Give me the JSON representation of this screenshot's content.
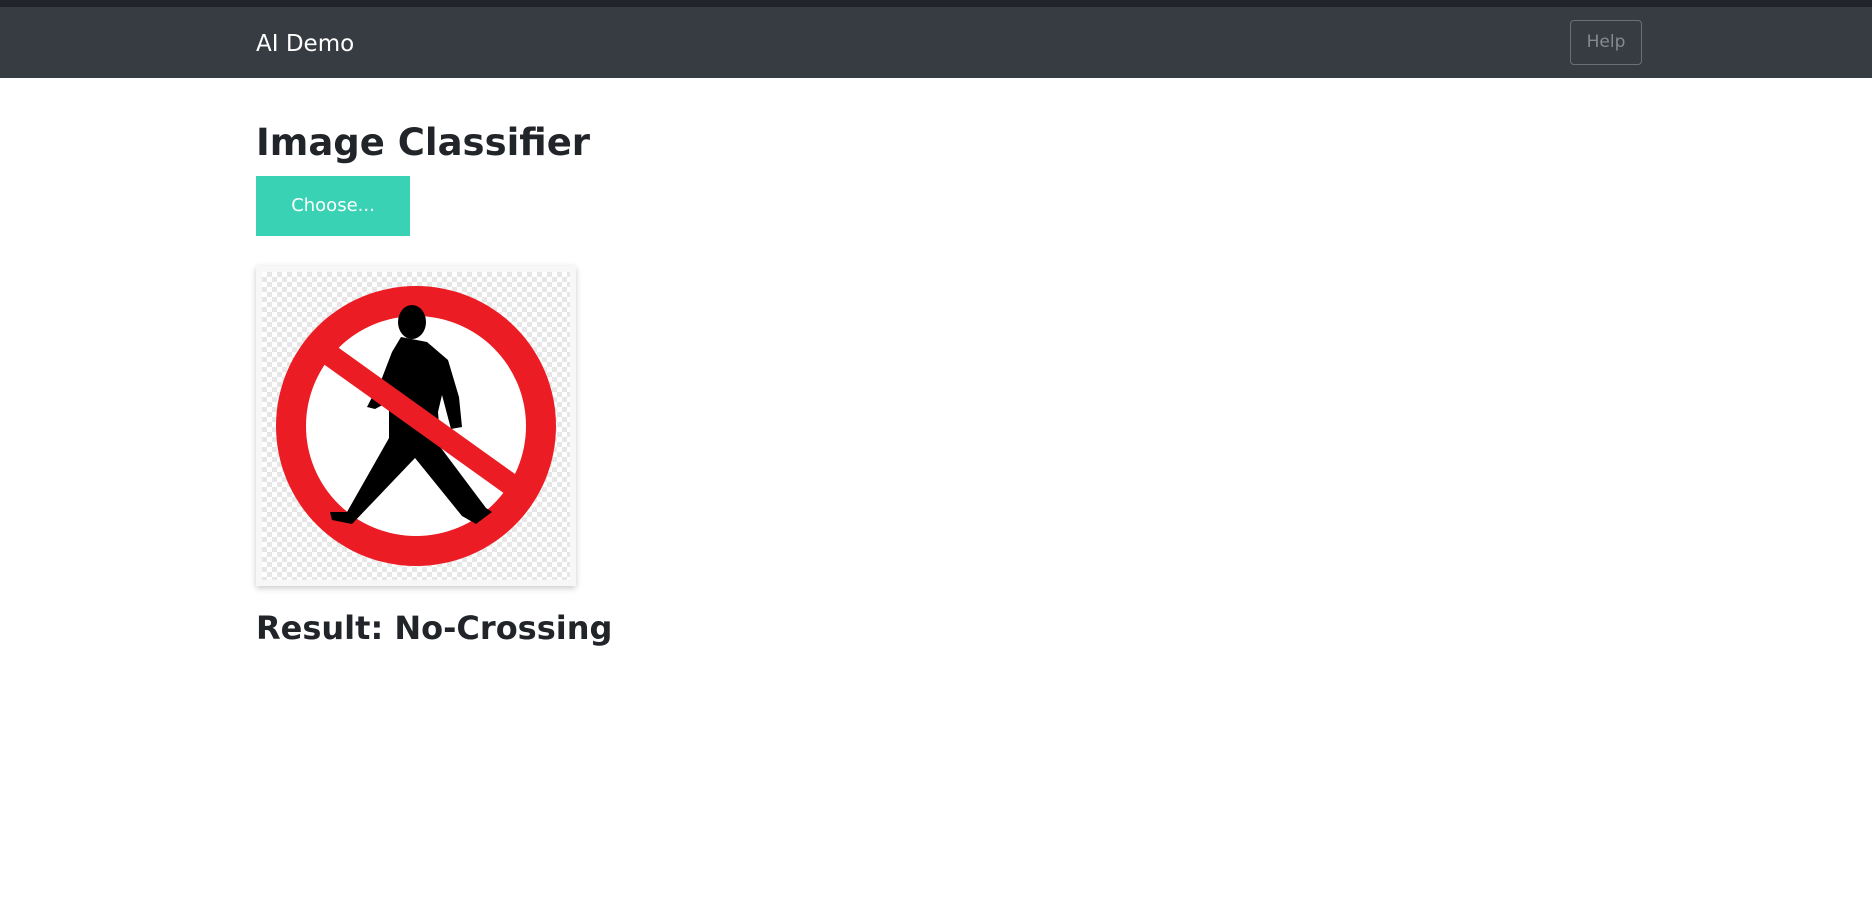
{
  "navbar": {
    "brand": "AI Demo",
    "help_label": "Help"
  },
  "main": {
    "title": "Image Classifier",
    "choose_label": "Choose...",
    "preview_icon": "no-pedestrian-crossing-sign",
    "result_text": "Result: No-Crossing"
  },
  "colors": {
    "navbar": "#373b42",
    "accent": "#3ad2b4",
    "sign_red": "#ec1c24"
  }
}
